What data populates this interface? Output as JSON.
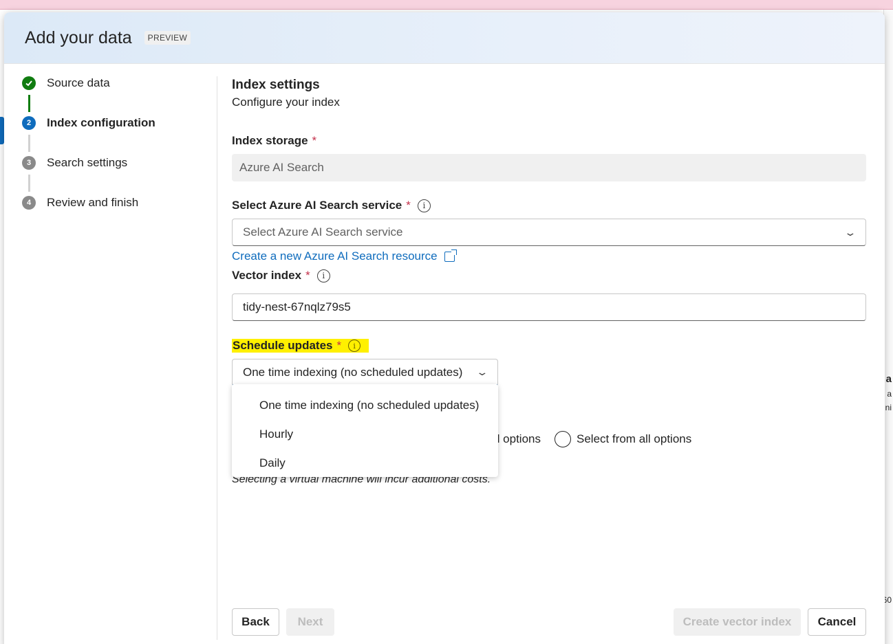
{
  "dialog": {
    "title": "Add your data",
    "badge": "PREVIEW"
  },
  "steps": [
    {
      "label": "Source data",
      "number": "1",
      "state": "done"
    },
    {
      "label": "Index configuration",
      "number": "2",
      "state": "current"
    },
    {
      "label": "Search settings",
      "number": "3",
      "state": "todo"
    },
    {
      "label": "Review and finish",
      "number": "4",
      "state": "todo"
    }
  ],
  "section": {
    "title": "Index settings",
    "subtitle": "Configure your index"
  },
  "index_storage": {
    "label": "Index storage",
    "required_mark": "*",
    "value": "Azure AI Search"
  },
  "search_service": {
    "label": "Select Azure AI Search service",
    "required_mark": "*",
    "placeholder": "Select Azure AI Search service",
    "create_link": "Create a new Azure AI Search resource"
  },
  "vector_index": {
    "label": "Vector index",
    "required_mark": "*",
    "value": "tidy-nest-67nqlz79s5"
  },
  "schedule": {
    "label": "Schedule updates",
    "required_mark": "*",
    "selected": "One time indexing (no scheduled updates)",
    "options": [
      "One time indexing (no scheduled updates)",
      "Hourly",
      "Daily"
    ],
    "highlight_color": "#fff000"
  },
  "vm_options": {
    "partial_label": "d options",
    "all_label": "Select from all options",
    "note": "Selecting a virtual machine will incur additional costs."
  },
  "footer": {
    "back": "Back",
    "next": "Next",
    "create": "Create vector index",
    "cancel": "Cancel"
  },
  "colors": {
    "accent": "#0f6cbd",
    "success": "#107c10",
    "required": "#c4314b"
  }
}
